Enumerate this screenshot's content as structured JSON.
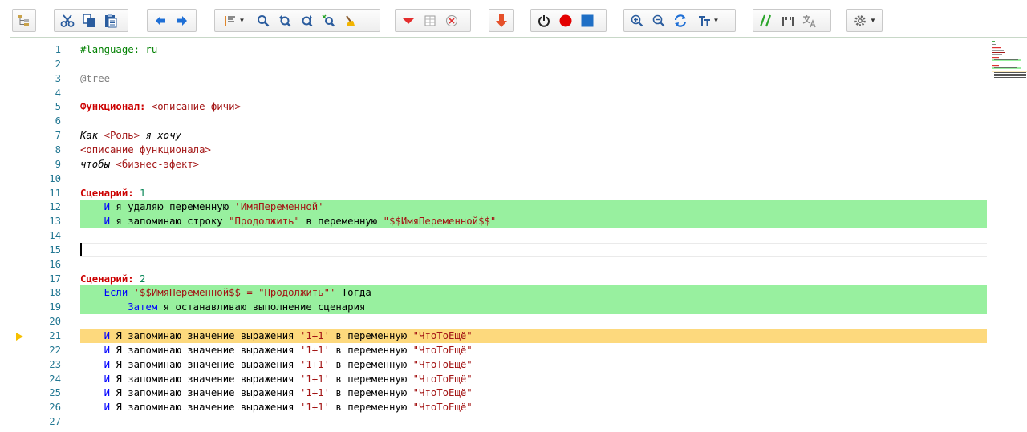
{
  "toolbar": {
    "groups": [
      {
        "name": "tree",
        "icons": [
          "tree-view-icon"
        ]
      },
      {
        "name": "clipboard",
        "icons": [
          "cut-icon",
          "copy-icon",
          "paste-icon"
        ]
      },
      {
        "name": "navigation",
        "icons": [
          "arrow-left-icon",
          "arrow-right-icon"
        ]
      },
      {
        "name": "search",
        "icons": [
          "bookmark-dropdown-icon",
          "search-icon",
          "find-prev-icon",
          "find-next-icon",
          "replace-icon",
          "clean-icon"
        ]
      },
      {
        "name": "steps",
        "icons": [
          "collapse-icon",
          "table-icon",
          "clear-icon"
        ]
      },
      {
        "name": "step-into",
        "icons": [
          "step-down-icon"
        ]
      },
      {
        "name": "execution",
        "icons": [
          "power-icon",
          "record-icon",
          "stop-icon"
        ]
      },
      {
        "name": "zoom",
        "icons": [
          "zoom-in-icon",
          "zoom-out-icon",
          "refresh-icon",
          "font-size-dropdown-icon"
        ]
      },
      {
        "name": "format",
        "icons": [
          "comment-icon",
          "quotes-icon",
          "translate-icon"
        ]
      },
      {
        "name": "settings",
        "icons": [
          "gear-dropdown-icon"
        ]
      }
    ],
    "colors": {
      "accent_red": "#e42d2d",
      "accent_blue": "#1e6fd6",
      "accent_green": "#2aa52a",
      "stop_blue": "#1f6fc5"
    }
  },
  "editor": {
    "line_numbers": [
      "1",
      "2",
      "3",
      "4",
      "5",
      "6",
      "7",
      "8",
      "9",
      "10",
      "11",
      "12",
      "13",
      "14",
      "15",
      "16",
      "17",
      "18",
      "19",
      "20",
      "21",
      "22",
      "23",
      "24",
      "25",
      "26",
      "27"
    ],
    "lines": [
      {
        "n": "1",
        "hl": "",
        "tokens": [
          {
            "t": "#language: ru",
            "c": "t-lang"
          }
        ]
      },
      {
        "n": "2",
        "hl": "",
        "tokens": []
      },
      {
        "n": "3",
        "hl": "",
        "tokens": [
          {
            "t": "@tree",
            "c": "t-tag"
          }
        ]
      },
      {
        "n": "4",
        "hl": "",
        "tokens": []
      },
      {
        "n": "5",
        "hl": "",
        "tokens": [
          {
            "t": "Функционал:",
            "c": "t-kw"
          },
          {
            "t": " ",
            "c": ""
          },
          {
            "t": "<описание фичи>",
            "c": "t-ph"
          }
        ]
      },
      {
        "n": "6",
        "hl": "",
        "tokens": []
      },
      {
        "n": "7",
        "hl": "",
        "tokens": [
          {
            "t": "Как ",
            "c": "t-it"
          },
          {
            "t": "<Роль>",
            "c": "t-ph"
          },
          {
            "t": " я хочу",
            "c": "t-it"
          }
        ]
      },
      {
        "n": "8",
        "hl": "",
        "tokens": [
          {
            "t": "<описание функционала>",
            "c": "t-ph"
          }
        ]
      },
      {
        "n": "9",
        "hl": "",
        "tokens": [
          {
            "t": "чтобы ",
            "c": "t-it"
          },
          {
            "t": "<бизнес-эфект>",
            "c": "t-ph"
          }
        ]
      },
      {
        "n": "10",
        "hl": "",
        "tokens": []
      },
      {
        "n": "11",
        "hl": "",
        "tokens": [
          {
            "t": "Сценарий:",
            "c": "t-kw"
          },
          {
            "t": " ",
            "c": ""
          },
          {
            "t": "1",
            "c": "t-num"
          }
        ]
      },
      {
        "n": "12",
        "hl": "green",
        "tokens": [
          {
            "t": "    ",
            "c": ""
          },
          {
            "t": "И",
            "c": "t-and"
          },
          {
            "t": " я удаляю переменную ",
            "c": ""
          },
          {
            "t": "'ИмяПеременной'",
            "c": "t-str"
          }
        ]
      },
      {
        "n": "13",
        "hl": "green",
        "tokens": [
          {
            "t": "    ",
            "c": ""
          },
          {
            "t": "И",
            "c": "t-and"
          },
          {
            "t": " я запоминаю строку ",
            "c": ""
          },
          {
            "t": "\"Продолжить\"",
            "c": "t-str"
          },
          {
            "t": " в переменную ",
            "c": ""
          },
          {
            "t": "\"$$ИмяПеременной$$\"",
            "c": "t-str"
          }
        ]
      },
      {
        "n": "14",
        "hl": "",
        "tokens": []
      },
      {
        "n": "15",
        "hl": "cursor",
        "tokens": []
      },
      {
        "n": "16",
        "hl": "",
        "tokens": []
      },
      {
        "n": "17",
        "hl": "",
        "tokens": [
          {
            "t": "Сценарий:",
            "c": "t-kw"
          },
          {
            "t": " ",
            "c": ""
          },
          {
            "t": "2",
            "c": "t-num"
          }
        ]
      },
      {
        "n": "18",
        "hl": "green",
        "tokens": [
          {
            "t": "    ",
            "c": ""
          },
          {
            "t": "Если",
            "c": "t-and"
          },
          {
            "t": " ",
            "c": ""
          },
          {
            "t": "'$$ИмяПеременной$$ = \"Продолжить\"'",
            "c": "t-str"
          },
          {
            "t": " Тогда",
            "c": ""
          }
        ]
      },
      {
        "n": "19",
        "hl": "green",
        "tokens": [
          {
            "t": "        ",
            "c": ""
          },
          {
            "t": "Затем",
            "c": "t-and"
          },
          {
            "t": " я останавливаю выполнение сценария",
            "c": ""
          }
        ]
      },
      {
        "n": "20",
        "hl": "",
        "tokens": []
      },
      {
        "n": "21",
        "hl": "yellow",
        "bp": true,
        "tokens": [
          {
            "t": "    ",
            "c": ""
          },
          {
            "t": "И",
            "c": "t-and"
          },
          {
            "t": " Я запоминаю значение выражения ",
            "c": ""
          },
          {
            "t": "'1+1'",
            "c": "t-str"
          },
          {
            "t": " в переменную ",
            "c": ""
          },
          {
            "t": "\"ЧтоТоЕщё\"",
            "c": "t-str"
          }
        ]
      },
      {
        "n": "22",
        "hl": "",
        "tokens": [
          {
            "t": "    ",
            "c": ""
          },
          {
            "t": "И",
            "c": "t-and"
          },
          {
            "t": " Я запоминаю значение выражения ",
            "c": ""
          },
          {
            "t": "'1+1'",
            "c": "t-str"
          },
          {
            "t": " в переменную ",
            "c": ""
          },
          {
            "t": "\"ЧтоТоЕщё\"",
            "c": "t-str"
          }
        ]
      },
      {
        "n": "23",
        "hl": "",
        "tokens": [
          {
            "t": "    ",
            "c": ""
          },
          {
            "t": "И",
            "c": "t-and"
          },
          {
            "t": " Я запоминаю значение выражения ",
            "c": ""
          },
          {
            "t": "'1+1'",
            "c": "t-str"
          },
          {
            "t": " в переменную ",
            "c": ""
          },
          {
            "t": "\"ЧтоТоЕщё\"",
            "c": "t-str"
          }
        ]
      },
      {
        "n": "24",
        "hl": "",
        "tokens": [
          {
            "t": "    ",
            "c": ""
          },
          {
            "t": "И",
            "c": "t-and"
          },
          {
            "t": " Я запоминаю значение выражения ",
            "c": ""
          },
          {
            "t": "'1+1'",
            "c": "t-str"
          },
          {
            "t": " в переменную ",
            "c": ""
          },
          {
            "t": "\"ЧтоТоЕщё\"",
            "c": "t-str"
          }
        ]
      },
      {
        "n": "25",
        "hl": "",
        "tokens": [
          {
            "t": "    ",
            "c": ""
          },
          {
            "t": "И",
            "c": "t-and"
          },
          {
            "t": " Я запоминаю значение выражения ",
            "c": ""
          },
          {
            "t": "'1+1'",
            "c": "t-str"
          },
          {
            "t": " в переменную ",
            "c": ""
          },
          {
            "t": "\"ЧтоТоЕщё\"",
            "c": "t-str"
          }
        ]
      },
      {
        "n": "26",
        "hl": "",
        "tokens": [
          {
            "t": "    ",
            "c": ""
          },
          {
            "t": "И",
            "c": "t-and"
          },
          {
            "t": " Я запоминаю значение выражения ",
            "c": ""
          },
          {
            "t": "'1+1'",
            "c": "t-str"
          },
          {
            "t": " в переменную ",
            "c": ""
          },
          {
            "t": "\"ЧтоТоЕщё\"",
            "c": "t-str"
          }
        ]
      },
      {
        "n": "27",
        "hl": "",
        "tokens": []
      }
    ]
  }
}
